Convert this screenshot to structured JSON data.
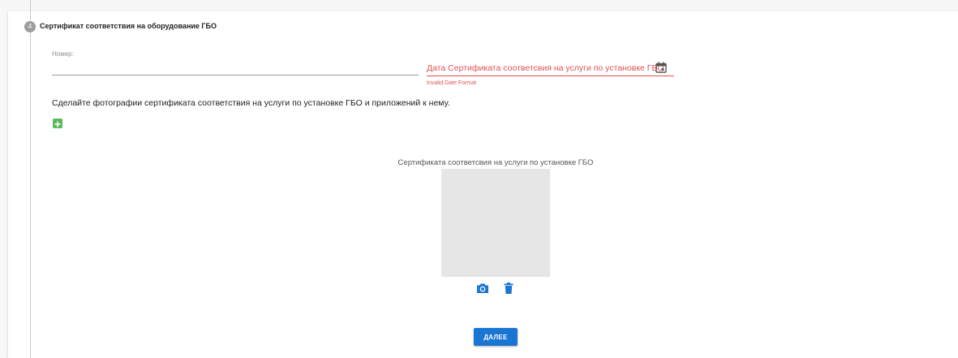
{
  "step": {
    "number": "4",
    "title": "Сертификат соответствия на оборудование ГБО"
  },
  "form": {
    "number_label": "Номер:",
    "number_value": "",
    "date_label": "Дата Сертификата соответсвия на услуги по установке ГБО",
    "date_error": "Invalid Date Format",
    "instruction": "Сделайте фотографии сертификата соответствия на услуги по установке ГБО и приложений к нему."
  },
  "photo": {
    "title": "Сертификата соответсвия на услуги по установке ГБО"
  },
  "actions": {
    "next_label": "ДАЛЕЕ"
  },
  "colors": {
    "accent": "#1976d2",
    "error": "#e05252",
    "add": "#5cb85c",
    "placeholder_box": "#e6e6e6"
  },
  "icons": [
    "calendar-icon",
    "add-icon",
    "camera-icon",
    "trash-icon"
  ]
}
